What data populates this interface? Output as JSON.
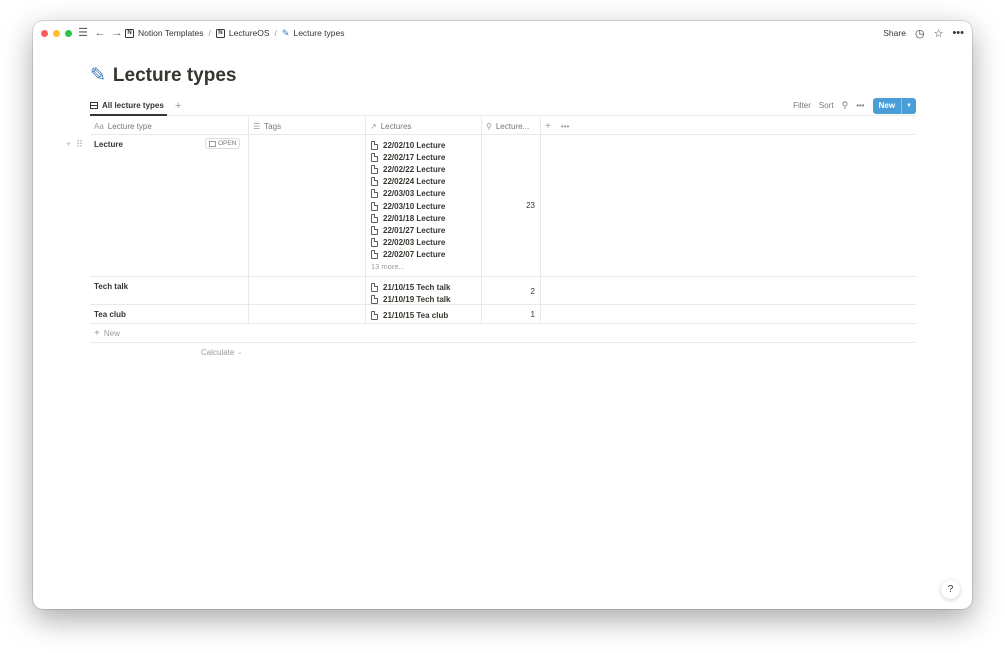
{
  "topbar": {
    "breadcrumb": [
      "Notion Templates",
      "LectureOS",
      "Lecture types"
    ],
    "share_label": "Share"
  },
  "page": {
    "title": "Lecture types",
    "title_icon": "pencil-icon"
  },
  "views": {
    "active_tab": "All lecture types",
    "actions": {
      "filter": "Filter",
      "sort": "Sort",
      "new": "New"
    },
    "new_button_color": "#4a9ed8"
  },
  "table": {
    "columns": [
      "Lecture type",
      "Tags",
      "Lectures",
      "Lecture..."
    ],
    "rows": [
      {
        "name": "Lecture",
        "open_label": "OPEN",
        "lectures": [
          "22/02/10 Lecture",
          "22/02/17 Lecture",
          "22/02/22 Lecture",
          "22/02/24 Lecture",
          "22/03/03 Lecture",
          "22/03/10 Lecture",
          "22/01/18 Lecture",
          "22/01/27 Lecture",
          "22/02/03 Lecture",
          "22/02/07 Lecture"
        ],
        "more": "13 more...",
        "count": "23"
      },
      {
        "name": "Tech talk",
        "lectures": [
          "21/10/15 Tech talk",
          "21/10/19 Tech talk"
        ],
        "count": "2"
      },
      {
        "name": "Tea club",
        "lectures": [
          "21/10/15 Tea club"
        ],
        "count": "1"
      }
    ],
    "new_row_label": "New",
    "calculate_label": "Calculate"
  },
  "help_label": "?"
}
